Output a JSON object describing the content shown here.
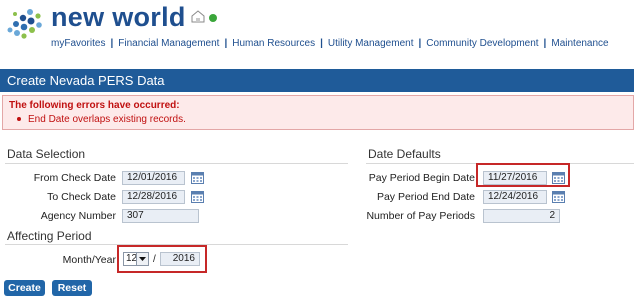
{
  "header": {
    "brand": "new world",
    "nav": [
      "myFavorites",
      "Financial Management",
      "Human Resources",
      "Utility Management",
      "Community Development",
      "Maintenance"
    ],
    "nav_separator": "|"
  },
  "page": {
    "title": "Create Nevada PERS Data"
  },
  "errors": {
    "heading": "The following errors have occurred:",
    "messages": [
      "End Date overlaps existing records."
    ]
  },
  "data_selection": {
    "heading": "Data Selection",
    "from_check_date": {
      "label": "From Check Date",
      "value": "12/01/2016"
    },
    "to_check_date": {
      "label": "To Check Date",
      "value": "12/28/2016"
    },
    "agency_number": {
      "label": "Agency Number",
      "value": "307"
    }
  },
  "affecting_period": {
    "heading": "Affecting Period",
    "label": "Month/Year",
    "month": "12",
    "separator": "/",
    "year": "2016"
  },
  "date_defaults": {
    "heading": "Date Defaults",
    "pay_period_begin": {
      "label": "Pay Period Begin Date",
      "value": "11/27/2016"
    },
    "pay_period_end": {
      "label": "Pay Period End Date",
      "value": "12/24/2016"
    },
    "num_pay_periods": {
      "label": "Number of Pay Periods",
      "value": "2"
    }
  },
  "buttons": {
    "create": "Create",
    "reset": "Reset"
  },
  "colors": {
    "brand": "#1f4f8f",
    "titlebar": "#1f5b99",
    "error": "#c01010",
    "highlight": "#c62828",
    "button": "#2166a8"
  }
}
